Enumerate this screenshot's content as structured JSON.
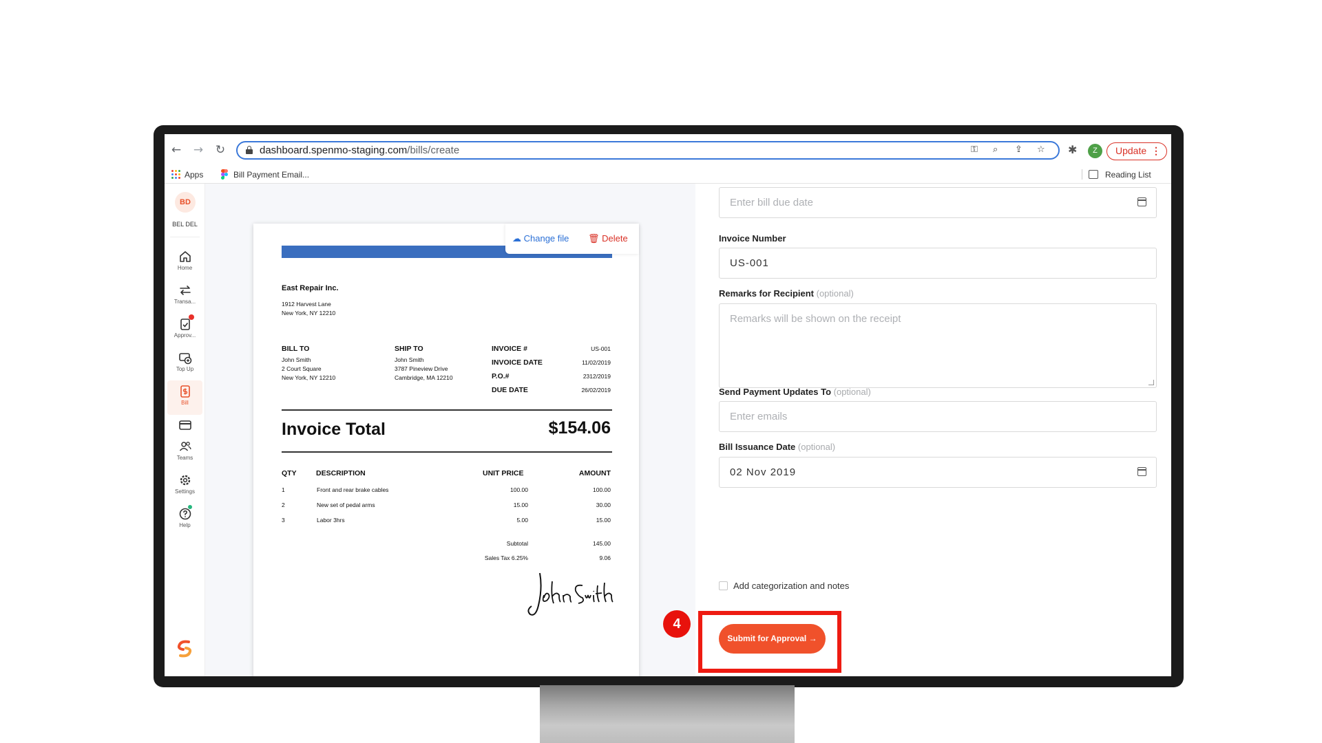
{
  "browser": {
    "url_domain": "dashboard.spenmo-staging.com",
    "url_path": "/bills/create",
    "profile_initial": "Z",
    "update_label": "Update",
    "bookmarks": [
      {
        "label": "Apps"
      },
      {
        "label": "Bill Payment Email..."
      }
    ],
    "reading_list_label": "Reading List"
  },
  "sidebar": {
    "avatar_initials": "BD",
    "user_name": "BEL DEL",
    "items": [
      {
        "label": "Home",
        "icon": "home-icon"
      },
      {
        "label": "Transa...",
        "icon": "transactions-icon"
      },
      {
        "label": "Approv...",
        "icon": "approvals-icon"
      },
      {
        "label": "Top Up",
        "icon": "topup-icon"
      },
      {
        "label": "Bill",
        "icon": "bill-icon",
        "active": true
      },
      {
        "label": "",
        "icon": "card-icon"
      },
      {
        "label": "Teams",
        "icon": "teams-icon"
      },
      {
        "label": "Settings",
        "icon": "settings-icon"
      },
      {
        "label": "Help",
        "icon": "help-icon"
      }
    ],
    "accent_color": "#e8512a"
  },
  "preview": {
    "change_file_label": "Change file",
    "delete_label": "Delete",
    "invoice": {
      "company": "East Repair Inc.",
      "company_address": [
        "1912 Harvest Lane",
        "New York, NY 12210"
      ],
      "bill_to_label": "BILL TO",
      "bill_to": [
        "John Smith",
        "2 Court Square",
        "New York, NY 12210"
      ],
      "ship_to_label": "SHIP TO",
      "ship_to": [
        "John Smith",
        "3787 Pineview Drive",
        "Cambridge, MA 12210"
      ],
      "meta": [
        {
          "label": "INVOICE #",
          "value": "US-001"
        },
        {
          "label": "INVOICE DATE",
          "value": "11/02/2019"
        },
        {
          "label": "P.O.#",
          "value": "2312/2019"
        },
        {
          "label": "DUE DATE",
          "value": "26/02/2019"
        }
      ],
      "total_label": "Invoice Total",
      "total_value": "$154.06",
      "columns": {
        "qty": "QTY",
        "description": "DESCRIPTION",
        "unit_price": "UNIT PRICE",
        "amount": "AMOUNT"
      },
      "lines": [
        {
          "qty": "1",
          "description": "Front and rear brake cables",
          "unit_price": "100.00",
          "amount": "100.00"
        },
        {
          "qty": "2",
          "description": "New set of pedal arms",
          "unit_price": "15.00",
          "amount": "30.00"
        },
        {
          "qty": "3",
          "description": "Labor 3hrs",
          "unit_price": "5.00",
          "amount": "15.00"
        }
      ],
      "subtotal_label": "Subtotal",
      "subtotal_value": "145.00",
      "tax_label": "Sales Tax 6.25%",
      "tax_value": "9.06",
      "signature_text": "John Smith"
    }
  },
  "form": {
    "due_date_placeholder": "Enter bill due date",
    "invoice_number_label": "Invoice Number",
    "invoice_number_value": "US-001",
    "remarks_label": "Remarks for Recipient",
    "remarks_placeholder": "Remarks will be shown on the receipt",
    "updates_label": "Send Payment Updates To",
    "updates_placeholder": "Enter emails",
    "issuance_label": "Bill Issuance Date",
    "issuance_value": "02 Nov 2019",
    "optional_tag": "(optional)",
    "categorization_label": "Add categorization and notes",
    "submit_label": "Submit for Approval",
    "submit_arrow": "→"
  },
  "tutorial": {
    "step_number": "4",
    "highlight_color": "#ee1b12"
  }
}
